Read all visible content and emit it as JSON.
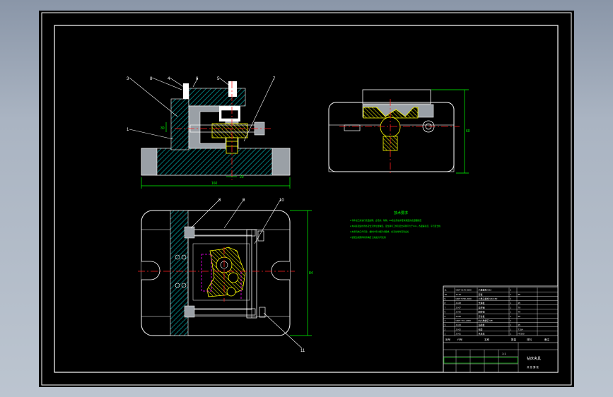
{
  "colors": {
    "background": "#000000",
    "frame": "#ffffff",
    "section": "#9aa0a6",
    "hatch": "#00c8c8",
    "dimension": "#00ff00",
    "centerline": "#ff2020",
    "part": "#ffff00",
    "magenta": "#ff00ff"
  },
  "balloons": {
    "front_view": [
      "3",
      "8",
      "4",
      "6",
      "5",
      "7",
      "1"
    ],
    "plan_view": [
      "8",
      "9",
      "10",
      "11"
    ]
  },
  "dimensions": {
    "front_width": "160",
    "plan_height": "84",
    "side_height": "60",
    "front_side": "30",
    "front_bottom": "20"
  },
  "notes": {
    "title": "技术要求",
    "lines": [
      "1.零件加工前进行表面处理，去毛刺、除锈，Ra值达到技术要求规定的表面粗糙度",
      "2.夹具装配后检查各定位元件位置精度，定位销与工件孔配合间隙不大于0.01，各面垂直度、平行度合格",
      "3.夹紧机构工作可靠，螺栓拧紧力矩符合要求，各活动零件润滑良好",
      "4.装配后按图样检验精度 合格后方可使用"
    ]
  },
  "title_block": {
    "parts_rows": [
      [
        "11",
        "GB/T 6170-2000",
        "六角螺母 M10",
        "2",
        "",
        ""
      ],
      [
        "10",
        "JJ-10",
        "压板",
        "1",
        "45",
        ""
      ],
      [
        "9",
        "GB/T 5782-2000",
        "六角头螺栓 M10×80",
        "2",
        "",
        ""
      ],
      [
        "8",
        "JJ-08",
        "支撑板",
        "1",
        "45",
        ""
      ],
      [
        "7",
        "JJ-07",
        "菱形销",
        "1",
        "T8",
        ""
      ],
      [
        "6",
        "JJ-06",
        "圆柱销",
        "1",
        "T8",
        ""
      ],
      [
        "5",
        "JJ-05",
        "定位板",
        "1",
        "45",
        ""
      ],
      [
        "4",
        "GB/T 70.1-2000",
        "内六角螺钉 M8",
        "4",
        "",
        ""
      ],
      [
        "3",
        "JJ-03",
        "钻模板",
        "1",
        "45",
        ""
      ],
      [
        "2",
        "JJ-02",
        "钻套",
        "1",
        "T10A",
        ""
      ],
      [
        "1",
        "JJ-01",
        "夹具体",
        "1",
        "HT200",
        ""
      ]
    ],
    "header": [
      "序号",
      "代号",
      "名称",
      "数量",
      "材料",
      "备注"
    ],
    "drawing_title": "钻床夹具",
    "scale": "1:1",
    "sheet_label": "共 张 第 张"
  }
}
